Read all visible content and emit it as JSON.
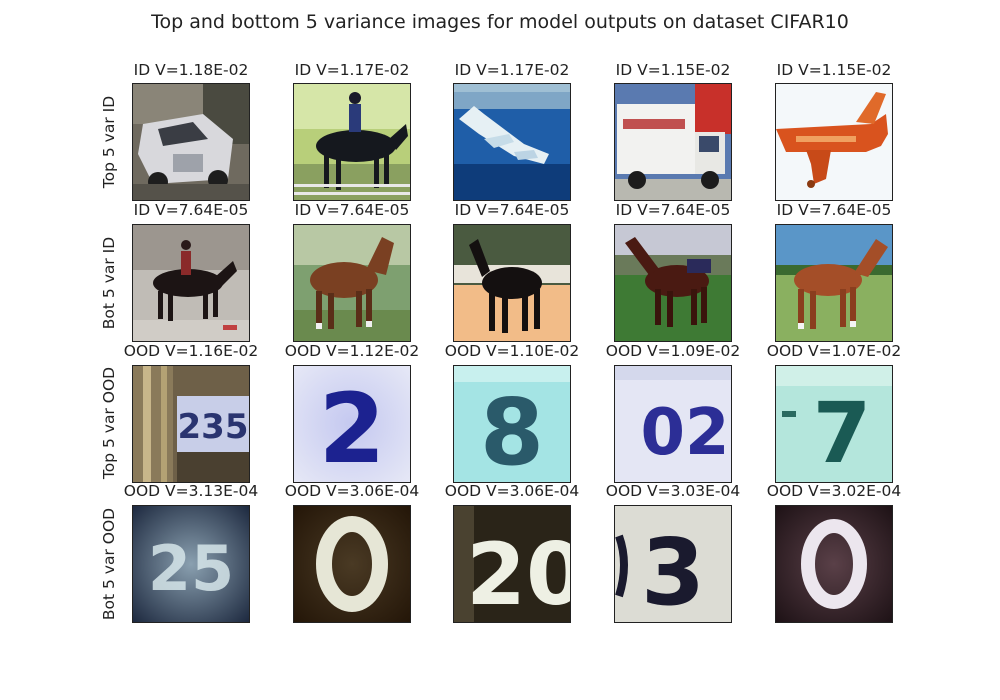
{
  "figure": {
    "title": "Top and bottom 5 variance images for model outputs on dataset CIFAR10"
  },
  "rows": [
    {
      "label": "Top 5 var ID",
      "panels": [
        {
          "title": "ID V=1.18E-02",
          "subject": "white car on street"
        },
        {
          "title": "ID V=1.17E-02",
          "subject": "rider on black horse"
        },
        {
          "title": "ID V=1.17E-02",
          "subject": "airplane over blue water"
        },
        {
          "title": "ID V=1.15E-02",
          "subject": "white delivery truck"
        },
        {
          "title": "ID V=1.15E-02",
          "subject": "orange airplane"
        }
      ]
    },
    {
      "label": "Bot 5 var ID",
      "panels": [
        {
          "title": "ID V=7.64E-05",
          "subject": "rider on dark horse"
        },
        {
          "title": "ID V=7.64E-05",
          "subject": "brown horse"
        },
        {
          "title": "ID V=7.64E-05",
          "subject": "black horse on sand"
        },
        {
          "title": "ID V=7.64E-05",
          "subject": "brown horse"
        },
        {
          "title": "ID V=7.64E-05",
          "subject": "brown horse on grass"
        }
      ]
    },
    {
      "label": "Top 5 var OOD",
      "panels": [
        {
          "title": "OOD V=1.16E-02",
          "subject": "house number 235"
        },
        {
          "title": "OOD V=1.12E-02",
          "subject": "digit 2"
        },
        {
          "title": "OOD V=1.10E-02",
          "subject": "digit 8"
        },
        {
          "title": "OOD V=1.09E-02",
          "subject": "digits 02"
        },
        {
          "title": "OOD V=1.07E-02",
          "subject": "digit 7"
        }
      ]
    },
    {
      "label": "Bot 5 var OOD",
      "panels": [
        {
          "title": "OOD V=3.13E-04",
          "subject": "digits 25"
        },
        {
          "title": "OOD V=3.06E-04",
          "subject": "digit 0"
        },
        {
          "title": "OOD V=3.06E-04",
          "subject": "digits 20"
        },
        {
          "title": "OOD V=3.03E-04",
          "subject": "digit 3"
        },
        {
          "title": "OOD V=3.02E-04",
          "subject": "digit 0"
        }
      ]
    }
  ]
}
